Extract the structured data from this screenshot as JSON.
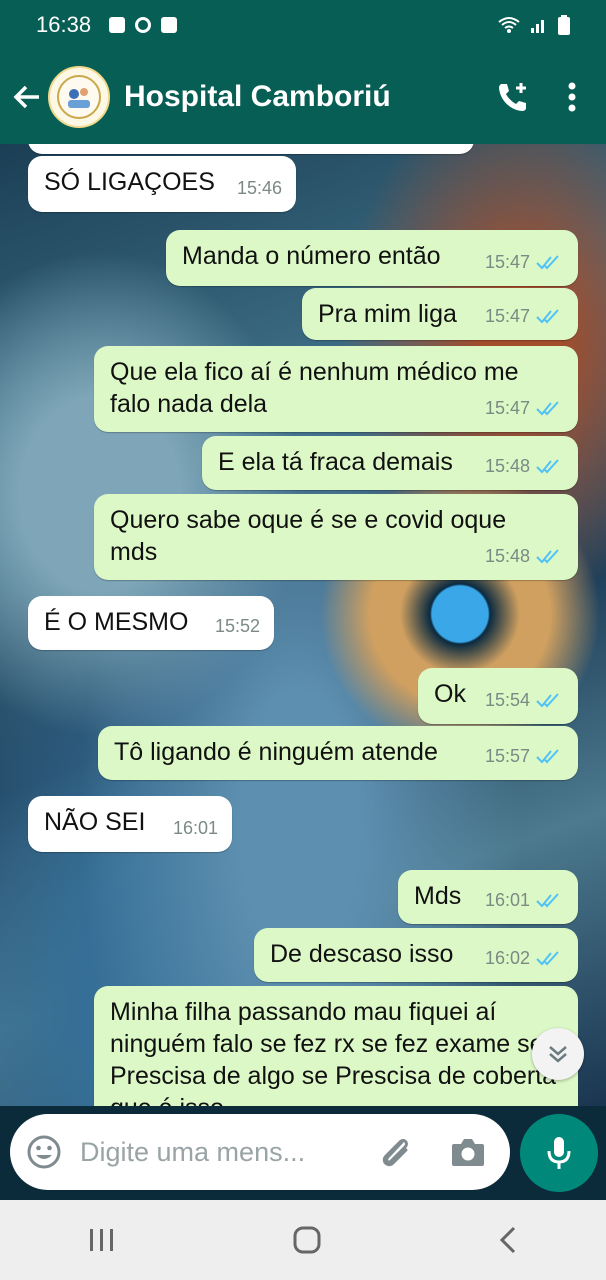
{
  "status_bar": {
    "time": "16:38"
  },
  "header": {
    "contact_name": "Hospital Camboriú"
  },
  "messages": [
    {
      "text": "SÓ LIGAÇOES",
      "time": "15:46"
    },
    {
      "text": "Manda o número  então",
      "time": "15:47"
    },
    {
      "text": "Pra mim liga",
      "time": "15:47"
    },
    {
      "text": "Que ela fico aí é nenhum médico me falo nada dela",
      "time": "15:47"
    },
    {
      "text": "E ela tá fraca demais",
      "time": "15:48"
    },
    {
      "text": "Quero sabe oque é se e covid oque mds",
      "time": "15:48"
    },
    {
      "text": "É O MESMO",
      "time": "15:52"
    },
    {
      "text": "Ok",
      "time": "15:54"
    },
    {
      "text": "Tô ligando é ninguém  atende",
      "time": "15:57"
    },
    {
      "text": "NÃO SEI",
      "time": "16:01"
    },
    {
      "text": "Mds",
      "time": "16:01"
    },
    {
      "text": "De descaso isso",
      "time": "16:02"
    },
    {
      "text": "Minha filha passando mau fiquei aí ninguém falo se fez rx se fez exame se Prescisa de algo se Prescisa de coberta que é isso"
    }
  ],
  "composer": {
    "placeholder": "Digite uma mens..."
  },
  "icons": {
    "back": "back-arrow-icon",
    "call": "add-call-icon",
    "menu": "more-vert-icon",
    "emoji": "emoji-icon",
    "attach": "paperclip-icon",
    "camera": "camera-icon",
    "mic": "mic-icon",
    "scroll": "chevron-double-down-icon"
  },
  "colors": {
    "header": "#075e54",
    "outgoing": "#dcf8c6",
    "incoming": "#ffffff",
    "read_tick": "#4fc3f7",
    "mic": "#00897b"
  }
}
